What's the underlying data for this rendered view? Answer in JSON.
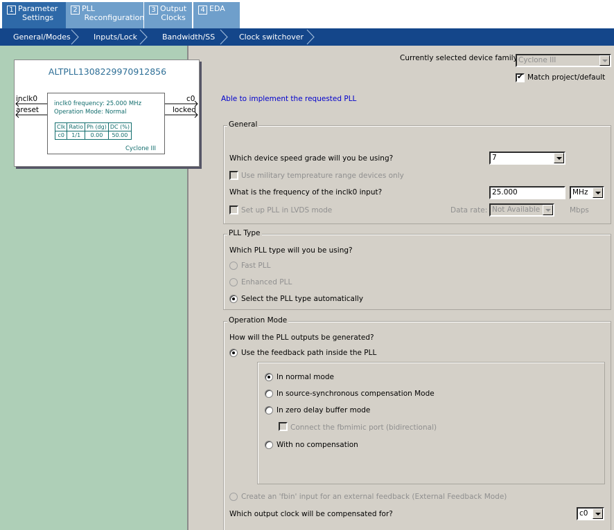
{
  "tabs": [
    {
      "num": "1",
      "line1": "Parameter",
      "line2": "Settings"
    },
    {
      "num": "2",
      "line1": "PLL",
      "line2": "Reconfiguration"
    },
    {
      "num": "3",
      "line1": "Output",
      "line2": "Clocks"
    },
    {
      "num": "4",
      "line1": "EDA",
      "line2": ""
    }
  ],
  "steps": [
    "General/Modes",
    "Inputs/Lock",
    "Bandwidth/SS",
    "Clock switchover"
  ],
  "diagram": {
    "title": "ALTPLL1308229970912856",
    "pins": {
      "inclk0": "inclk0",
      "areset": "areset",
      "c0": "c0",
      "locked": "locked"
    },
    "freq": "inclk0 frequency: 25.000 MHz",
    "mode": "Operation Mode: Normal",
    "table_headers": [
      "Clk",
      "Ratio",
      "Ph (dg)",
      "DC (%)"
    ],
    "table_row": [
      "c0",
      "1/1",
      "0.00",
      "50.00"
    ],
    "family": "Cyclone III"
  },
  "device": {
    "label": "Currently selected device family:",
    "value": "Cyclone III",
    "match_label": "Match project/default",
    "match_checked": true
  },
  "status": "Able to implement the requested PLL",
  "general": {
    "title": "General",
    "speed_q": "Which device speed grade will you be using?",
    "speed_value": "7",
    "military_label": "Use military tempreature range devices only",
    "freq_q": "What is the frequency of the inclk0 input?",
    "freq_value": "25.000",
    "freq_unit": "MHz",
    "lvds_label": "Set up PLL in LVDS mode",
    "data_rate_label": "Data rate:",
    "data_rate_value": "Not Available",
    "data_rate_unit": "Mbps"
  },
  "pll_type": {
    "title": "PLL Type",
    "question": "Which PLL type will you be using?",
    "options": [
      "Fast PLL",
      "Enhanced PLL",
      "Select the PLL type automatically"
    ],
    "selected": 2
  },
  "op_mode": {
    "title": "Operation Mode",
    "question": "How will the PLL outputs be generated?",
    "feedback_label": "Use the feedback path inside the PLL",
    "modes": [
      "In normal mode",
      "In source-synchronous compensation Mode",
      "In zero delay buffer mode",
      "With no compensation"
    ],
    "fbmimic_label": "Connect the fbmimic port (bidirectional)",
    "external_label": "Create an 'fbin' input for an external feedback (External Feedback Mode)",
    "compensate_q": "Which output clock will be compensated for?",
    "compensate_value": "c0"
  }
}
